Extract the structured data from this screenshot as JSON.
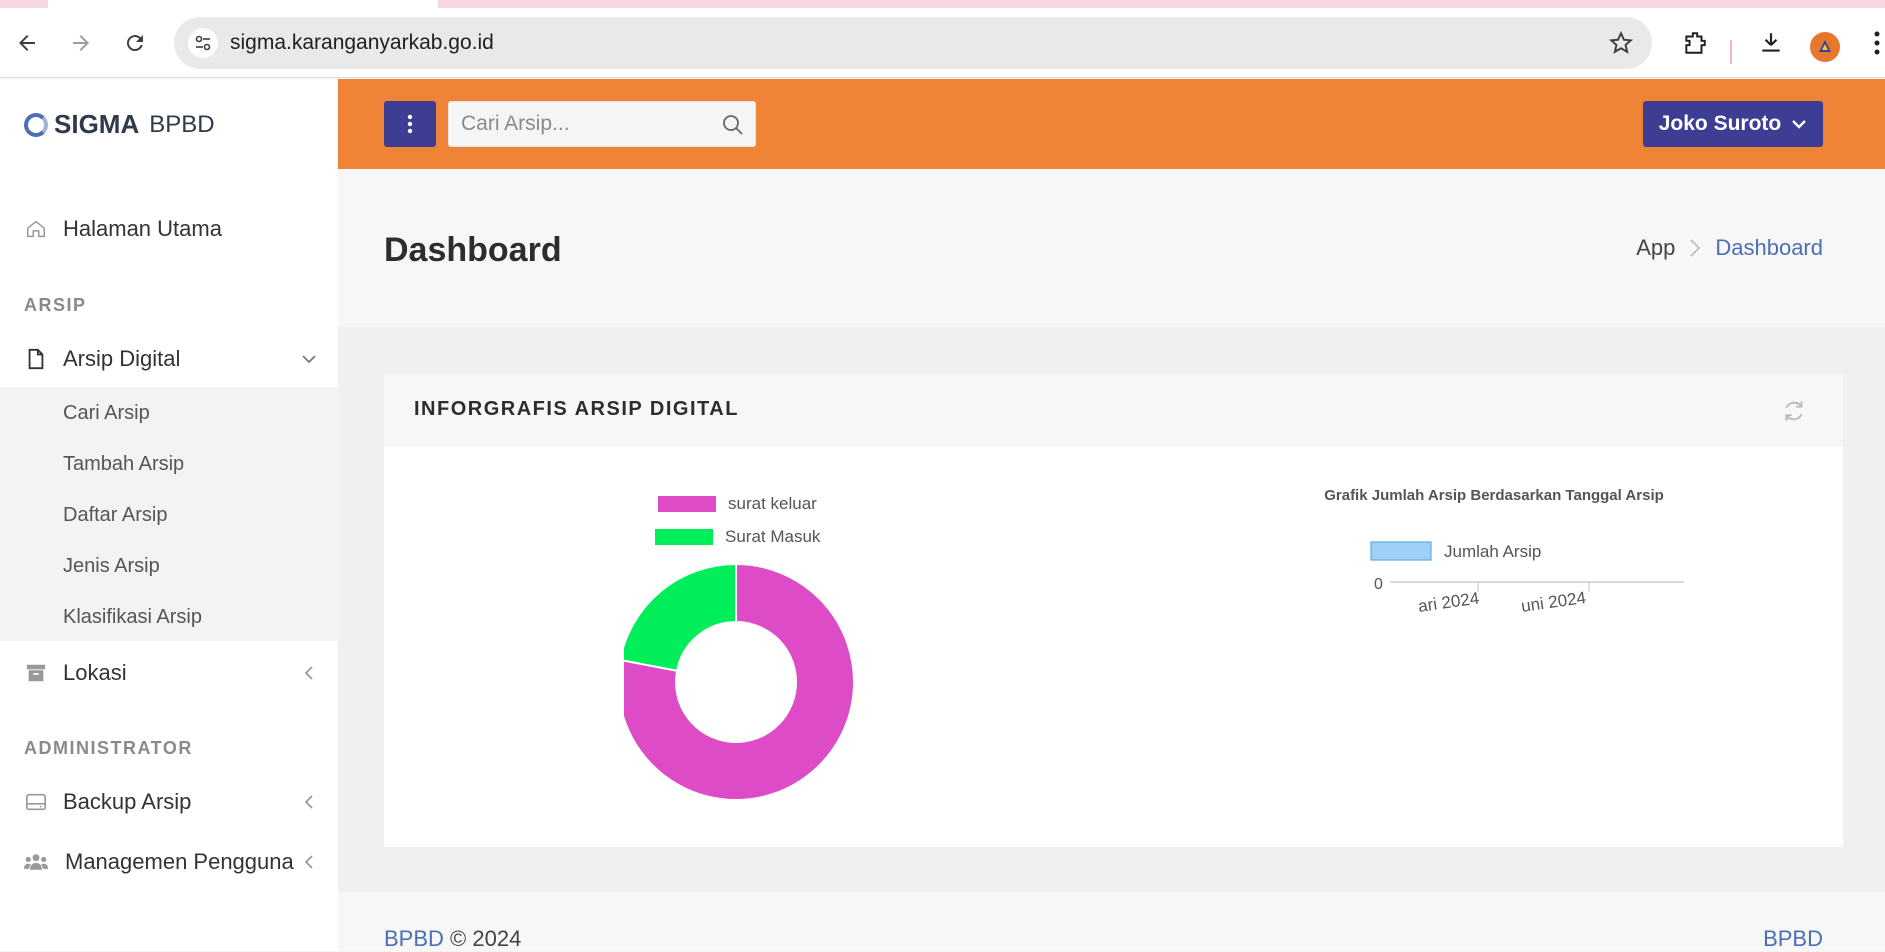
{
  "browser": {
    "url": "sigma.karanganyarkab.go.id"
  },
  "sidebar": {
    "brand_name": "SIGMA",
    "brand_sub": "BPBD",
    "home_label": "Halaman Utama",
    "section_arsip": "ARSIP",
    "arsip_digital_label": "Arsip Digital",
    "submenu": [
      "Cari Arsip",
      "Tambah Arsip",
      "Daftar Arsip",
      "Jenis Arsip",
      "Klasifikasi Arsip"
    ],
    "lokasi_label": "Lokasi",
    "section_admin": "ADMINISTRATOR",
    "backup_label": "Backup Arsip",
    "manage_users_label": "Managemen Pengguna"
  },
  "topbar": {
    "search_placeholder": "Cari Arsip...",
    "user_name": "Joko Suroto"
  },
  "content": {
    "page_title": "Dashboard",
    "breadcrumb_app": "App",
    "breadcrumb_current": "Dashboard",
    "panel_title": "INFORGRAFIS ARSIP DIGITAL"
  },
  "chart_data": [
    {
      "type": "pie",
      "legend": [
        "surat keluar",
        "Surat Masuk"
      ],
      "values": [
        78,
        22
      ],
      "colors": [
        "#dd4bc6",
        "#00ee5a"
      ],
      "title": ""
    },
    {
      "type": "line",
      "title": "Grafik Jumlah Arsip Berdasarkan Tanggal Arsip",
      "series": [
        {
          "name": "Jumlah Arsip",
          "values": []
        }
      ],
      "tick_labels_x": [
        "ari 2024",
        "uni 2024"
      ],
      "tick_labels_y": [
        "0"
      ],
      "colors": [
        "#9fd0f5"
      ]
    }
  ],
  "footer": {
    "brand": "BPBD",
    "copyright": "© 2024",
    "right_link": "BPBD"
  }
}
